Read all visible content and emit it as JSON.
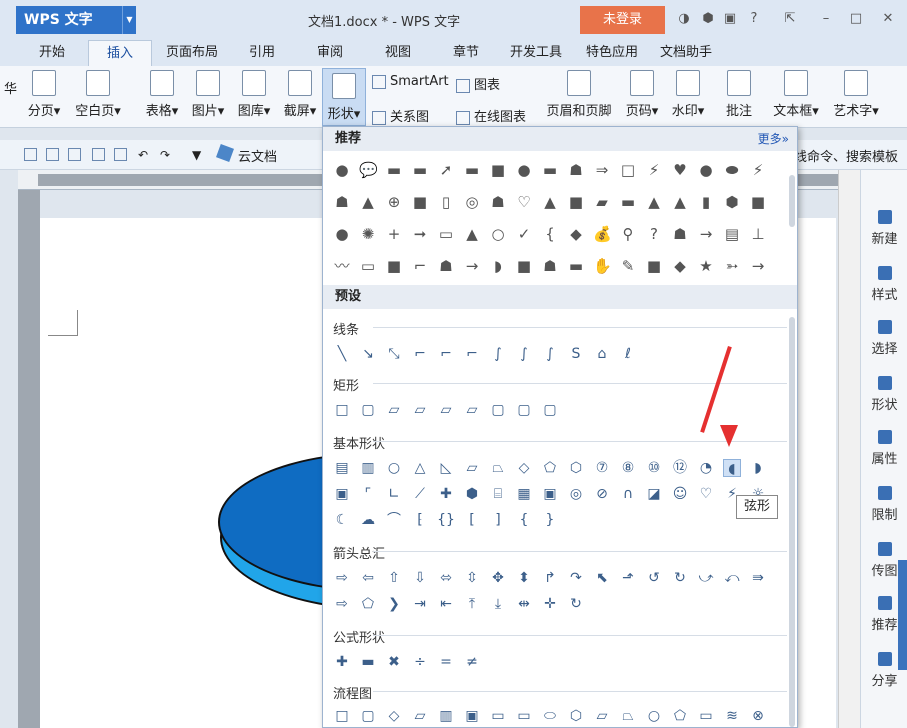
{
  "title_bar": {
    "app_name": "WPS 文字",
    "document_title": "文档1.docx * - WPS 文字",
    "login_label": "未登录"
  },
  "tabs": [
    "开始",
    "插入",
    "页面布局",
    "引用",
    "审阅",
    "视图",
    "章节",
    "开发工具",
    "特色应用",
    "文档助手"
  ],
  "active_tab": "插入",
  "ribbon": {
    "page_break": "分页",
    "blank_page": "空白页",
    "table": "表格",
    "picture": "图片",
    "gallery": "图库",
    "screenshot": "截屏",
    "shapes": "形状",
    "smartart": "SmartArt",
    "chart": "图表",
    "relation_chart": "关系图",
    "online_chart": "在线图表",
    "header_footer": "页眉和页脚",
    "page_number": "页码",
    "watermark": "水印",
    "comment": "批注",
    "textbox": "文本框",
    "wordart": "艺术字"
  },
  "quickbar": {
    "cloud_doc": "云文档",
    "right_text": "线命令、搜索模板"
  },
  "left_clip": "华",
  "shape_panel": {
    "recommended_title": "推荐",
    "more_label": "更多»",
    "preset_title": "预设",
    "groups": [
      "线条",
      "矩形",
      "基本形状",
      "箭头总汇",
      "公式形状",
      "流程图"
    ],
    "tooltip": "弦形"
  },
  "sidebar": [
    "新建",
    "样式",
    "选择",
    "形状",
    "属性",
    "限制",
    "传图",
    "推荐",
    "分享"
  ],
  "colors": {
    "accent": "#2f73c9",
    "login": "#e8734a",
    "oval_top": "#0f6cc2",
    "oval_side": "#21a5e9",
    "arrow": "#e53030"
  }
}
